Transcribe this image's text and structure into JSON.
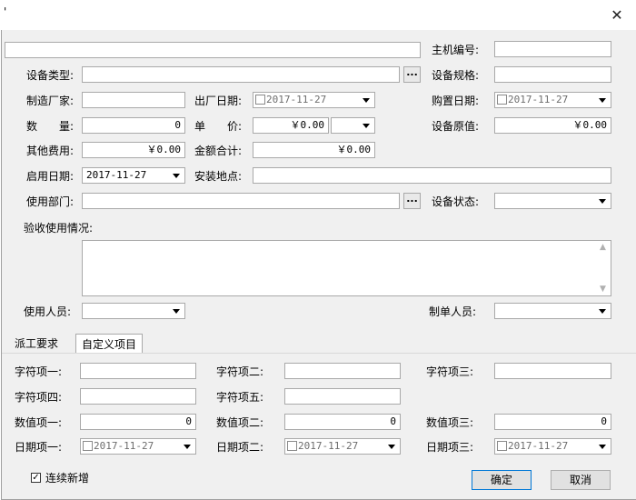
{
  "window": {
    "title": "'",
    "close_glyph": "✕"
  },
  "form": {
    "host_no_label": "主机编号:",
    "device_type_label": "设备类型:",
    "device_spec_label": "设备规格:",
    "manufacturer_label": "制造厂家:",
    "factory_date_label": "出厂日期:",
    "factory_date_value": "2017-11-27",
    "purchase_date_label": "购置日期:",
    "purchase_date_value": "2017-11-27",
    "quantity_label": "数　　量:",
    "quantity_value": "0",
    "unit_price_label": "单　　价:",
    "unit_price_value": "￥0.00",
    "original_value_label": "设备原值:",
    "original_value_value": "￥0.00",
    "other_fee_label": "其他费用:",
    "other_fee_value": "￥0.00",
    "total_label": "金额合计:",
    "total_value": "￥0.00",
    "enable_date_label": "启用日期:",
    "enable_date_value": "2017-11-27",
    "install_location_label": "安装地点:",
    "department_label": "使用部门:",
    "device_status_label": "设备状态:",
    "acceptance_label": "验收使用情况:",
    "user_label": "使用人员:",
    "creator_label": "制单人员:",
    "ellipsis": "..."
  },
  "tabs": [
    {
      "label": "派工要求"
    },
    {
      "label": "自定义项目"
    }
  ],
  "custom": {
    "char1_label": "字符项一:",
    "char2_label": "字符项二:",
    "char3_label": "字符项三:",
    "char4_label": "字符项四:",
    "char5_label": "字符项五:",
    "num1_label": "数值项一:",
    "num1_value": "0",
    "num2_label": "数值项二:",
    "num2_value": "0",
    "num3_label": "数值项三:",
    "num3_value": "0",
    "date1_label": "日期项一:",
    "date1_value": "2017-11-27",
    "date2_label": "日期项二:",
    "date2_value": "2017-11-27",
    "date3_label": "日期项三:",
    "date3_value": "2017-11-27"
  },
  "footer": {
    "continue_label": "连续新增",
    "continue_checked": true,
    "ok_label": "确定",
    "cancel_label": "取消"
  }
}
